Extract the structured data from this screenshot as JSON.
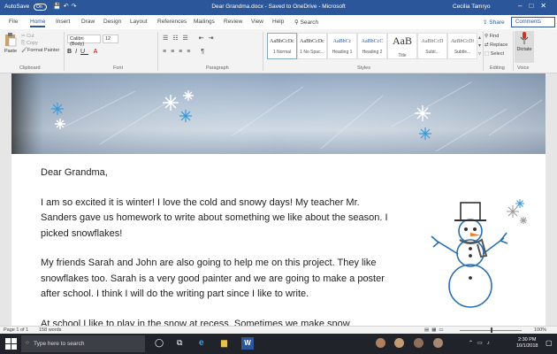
{
  "titlebar": {
    "autosave_label": "AutoSave",
    "autosave_state": "On",
    "document_title": "Dear Grandma.docx - Saved to OneDrive - Microsoft",
    "user_name": "Cecilia Tamryo"
  },
  "tabs": [
    {
      "label": "File"
    },
    {
      "label": "Home"
    },
    {
      "label": "Insert"
    },
    {
      "label": "Draw"
    },
    {
      "label": "Design"
    },
    {
      "label": "Layout"
    },
    {
      "label": "References"
    },
    {
      "label": "Mailings"
    },
    {
      "label": "Review"
    },
    {
      "label": "View"
    },
    {
      "label": "Help"
    }
  ],
  "search_label": "Search",
  "share_label": "Share",
  "comments_label": "Comments",
  "clipboard": {
    "paste": "Paste",
    "cut": "Cut",
    "copy": "Copy",
    "format_painter": "Format Painter",
    "group": "Clipboard"
  },
  "font": {
    "name": "Calibri (Body)",
    "size": "12",
    "group": "Font"
  },
  "paragraph_group": "Paragraph",
  "styles": {
    "group": "Styles",
    "items": [
      {
        "sample": "AaBbCcDc",
        "name": "1 Normal"
      },
      {
        "sample": "AaBbCcDc",
        "name": "1 No Spac..."
      },
      {
        "sample": "AaBbCc",
        "name": "Heading 1"
      },
      {
        "sample": "AaBbCcC",
        "name": "Heading 2"
      },
      {
        "sample": "AaB",
        "name": "Title"
      },
      {
        "sample": "AaBbCcD",
        "name": "Subti..."
      },
      {
        "sample": "AaBbCcDi",
        "name": "Subtle..."
      }
    ]
  },
  "editing": {
    "find": "Find",
    "replace": "Replace",
    "select": "Select",
    "group": "Editing"
  },
  "voice": {
    "dictate": "Dictate",
    "group": "Voice"
  },
  "letter": {
    "greeting": "Dear Grandma,",
    "paragraph1": "I am so excited it is winter! I love the cold and snowy days! My teacher Mr. Sanders gave us homework to write about something we like about the season. I picked snowflakes!",
    "paragraph2": "My friends Sarah and John are also going to help me on this project. They like snowflakes too. Sarah is a very good painter and we are going to make a poster after school. I think I will do the writing part since I like to write.",
    "paragraph3": "At school I like to play in the snow at recess. Sometimes we make snow"
  },
  "statusbar": {
    "page": "Page 1 of 1",
    "words": "158 words",
    "zoom": "100%"
  },
  "taskbar": {
    "search_placeholder": "Type here to search",
    "time": "2:30 PM",
    "date": "10/1/2018"
  },
  "colors": {
    "word_blue": "#2b579a",
    "taskbar": "#20232a"
  }
}
